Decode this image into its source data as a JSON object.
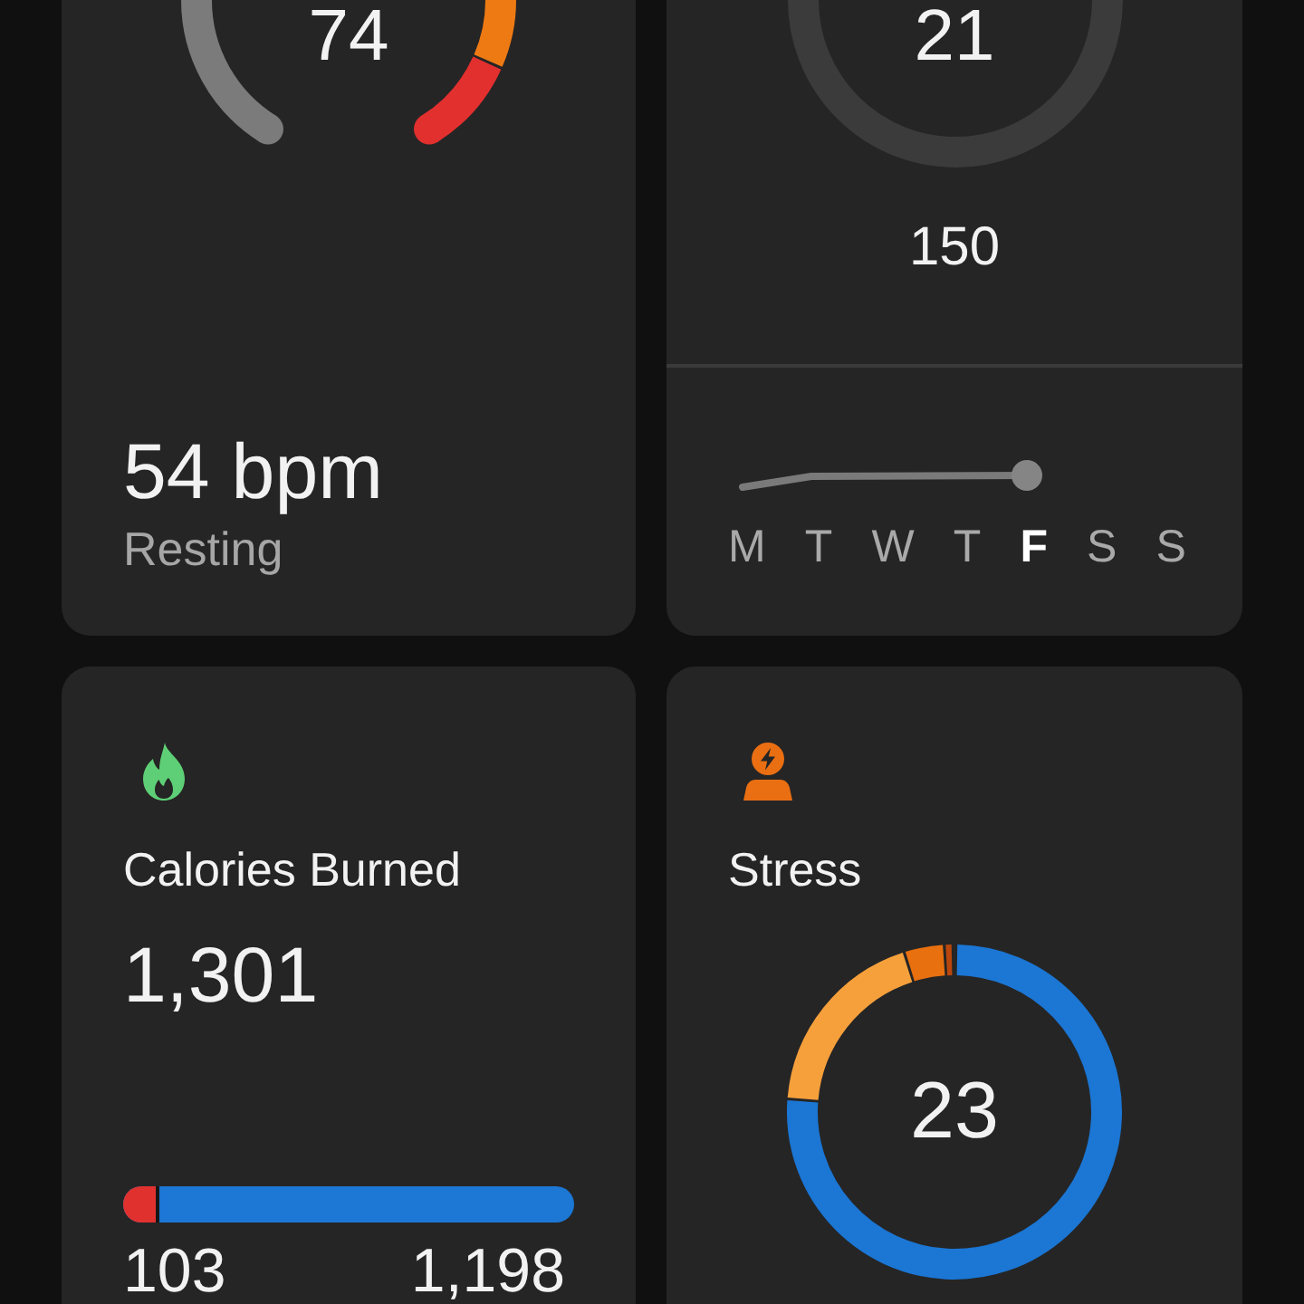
{
  "cards": [
    {
      "kind": "heart_rate",
      "gauge_value": "74",
      "value": "54 bpm",
      "caption": "Resting"
    },
    {
      "kind": "weekly_goal",
      "ring_value": "21",
      "goal": "150",
      "days": [
        {
          "label": "M",
          "selected": false
        },
        {
          "label": "T",
          "selected": false
        },
        {
          "label": "W",
          "selected": false
        },
        {
          "label": "T",
          "selected": false
        },
        {
          "label": "F",
          "selected": true
        },
        {
          "label": "S",
          "selected": false
        },
        {
          "label": "S",
          "selected": false
        }
      ]
    },
    {
      "kind": "calories",
      "title": "Calories Burned",
      "value": "1,301",
      "bar": {
        "level": 0.08
      },
      "bar_start": "103",
      "bar_end": "1,198"
    },
    {
      "kind": "stress",
      "title": "Stress",
      "ring_value": "23"
    }
  ]
}
